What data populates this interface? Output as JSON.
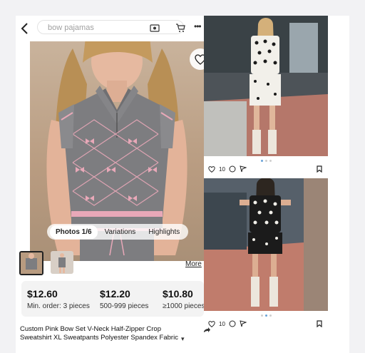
{
  "search": {
    "value": "bow pajamas"
  },
  "photo_tabs": [
    {
      "label": "Photos 1/6",
      "active": true
    },
    {
      "label": "Variations",
      "active": false
    },
    {
      "label": "Highlights",
      "active": false
    }
  ],
  "more_link": "More",
  "price_tiers": [
    {
      "price": "$12.60",
      "qty": "Min. order: 3 pieces"
    },
    {
      "price": "$12.20",
      "qty": "500-999 pieces"
    },
    {
      "price": "$10.80",
      "qty": "≥1000 pieces"
    }
  ],
  "product_title_line1": "Custom Pink Bow Set V-Neck Half-Zipper Crop",
  "product_title_line2": "Sweatshirt XL Sweatpants Polyester Spandex Fabric",
  "posts": [
    {
      "like_count": "10"
    },
    {
      "like_count": "10"
    }
  ],
  "colors": {
    "sweater_gray": "#7d7d80",
    "bow_pink": "#e8a8b8",
    "accent_blue": "#6aa3d8"
  }
}
